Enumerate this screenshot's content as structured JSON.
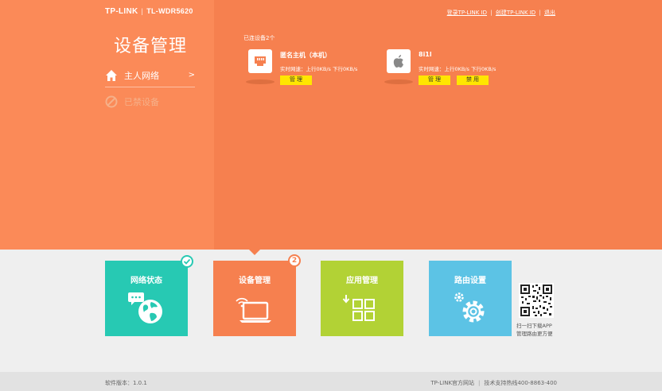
{
  "header": {
    "brand": "TP-LINK",
    "model": "TL-WDR5620",
    "links": [
      "登录TP-LINK ID",
      "创建TP-LINK ID",
      "退出"
    ]
  },
  "sidebar": {
    "title": "设备管理",
    "items": [
      {
        "label": "主人网络",
        "chevron": ">",
        "icon": "home-icon"
      },
      {
        "label": "已禁设备",
        "icon": "blocked-icon"
      }
    ]
  },
  "main": {
    "count_label": "已连设备2个",
    "devices": [
      {
        "name": "匿名主机（本机）",
        "speed": "实时网速：上行0KB/s  下行0KB/s",
        "icon": "ethernet-icon",
        "buttons": [
          "管 理"
        ]
      },
      {
        "name": "8i1l",
        "speed": "实时网速：上行0KB/s  下行0KB/s",
        "icon": "apple-icon",
        "buttons": [
          "管 理",
          "禁 用"
        ]
      }
    ]
  },
  "tiles": [
    {
      "label": "网络状态",
      "icon": "globe-icon",
      "color": "#27c9b3"
    },
    {
      "label": "设备管理",
      "icon": "laptop-icon",
      "color": "#f6804f",
      "badge": "2"
    },
    {
      "label": "应用管理",
      "icon": "apps-grid-icon",
      "color": "#b2d235"
    },
    {
      "label": "路由设置",
      "icon": "gear-icon",
      "color": "#5cc3e5"
    }
  ],
  "qr": {
    "line1": "扫一扫下载APP",
    "line2": "管理路由更方便"
  },
  "footer": {
    "version": "软件版本：1.0.1",
    "site": "TP-LINK官方网站",
    "hotline": "技术支持热线400-8863-400"
  },
  "colors": {
    "orange_left": "#fb8a58",
    "orange_right": "#f6804f",
    "button_yellow": "#ffe600"
  }
}
